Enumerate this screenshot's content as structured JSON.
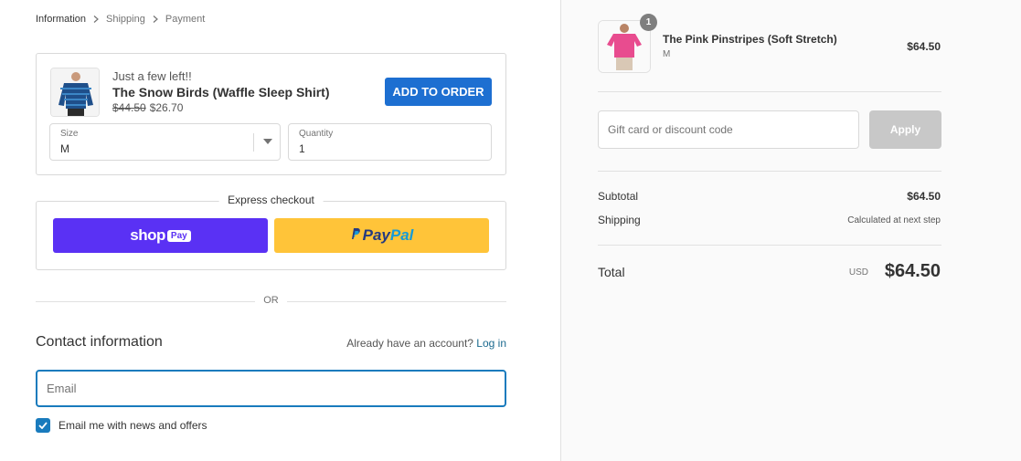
{
  "breadcrumb": [
    {
      "label": "Information"
    },
    {
      "label": "Shipping"
    },
    {
      "label": "Payment"
    }
  ],
  "upsell": {
    "stock_note": "Just a few left!!",
    "product_name": "The Snow Birds (Waffle Sleep Shirt)",
    "old_price": "$44.50",
    "new_price": "$26.70",
    "add_button": "ADD TO ORDER",
    "size_label": "Size",
    "size_value": "M",
    "quantity_label": "Quantity",
    "quantity_value": "1"
  },
  "express": {
    "title": "Express checkout",
    "shoppay_word": "shop",
    "shoppay_pill": "Pay",
    "paypal_a": "Pay",
    "paypal_b": "Pal"
  },
  "divider_text": "OR",
  "contact": {
    "heading": "Contact information",
    "account_prompt": "Already have an account?",
    "login_link": "Log in",
    "email_placeholder": "Email",
    "newsletter_label": "Email me with news and offers",
    "newsletter_checked": true
  },
  "summary": {
    "item": {
      "quantity_badge": "1",
      "name": "The Pink Pinstripes (Soft Stretch)",
      "variant": "M",
      "price": "$64.50"
    },
    "discount_placeholder": "Gift card or discount code",
    "apply_button": "Apply",
    "subtotal_label": "Subtotal",
    "subtotal_value": "$64.50",
    "shipping_label": "Shipping",
    "shipping_value": "Calculated at next step",
    "total_label": "Total",
    "total_currency": "USD",
    "total_value": "$64.50"
  },
  "colors": {
    "accent_blue": "#197bbd",
    "add_button_blue": "#1d6fd1",
    "shoppay_purple": "#5a31f4",
    "paypal_yellow": "#ffc439"
  }
}
